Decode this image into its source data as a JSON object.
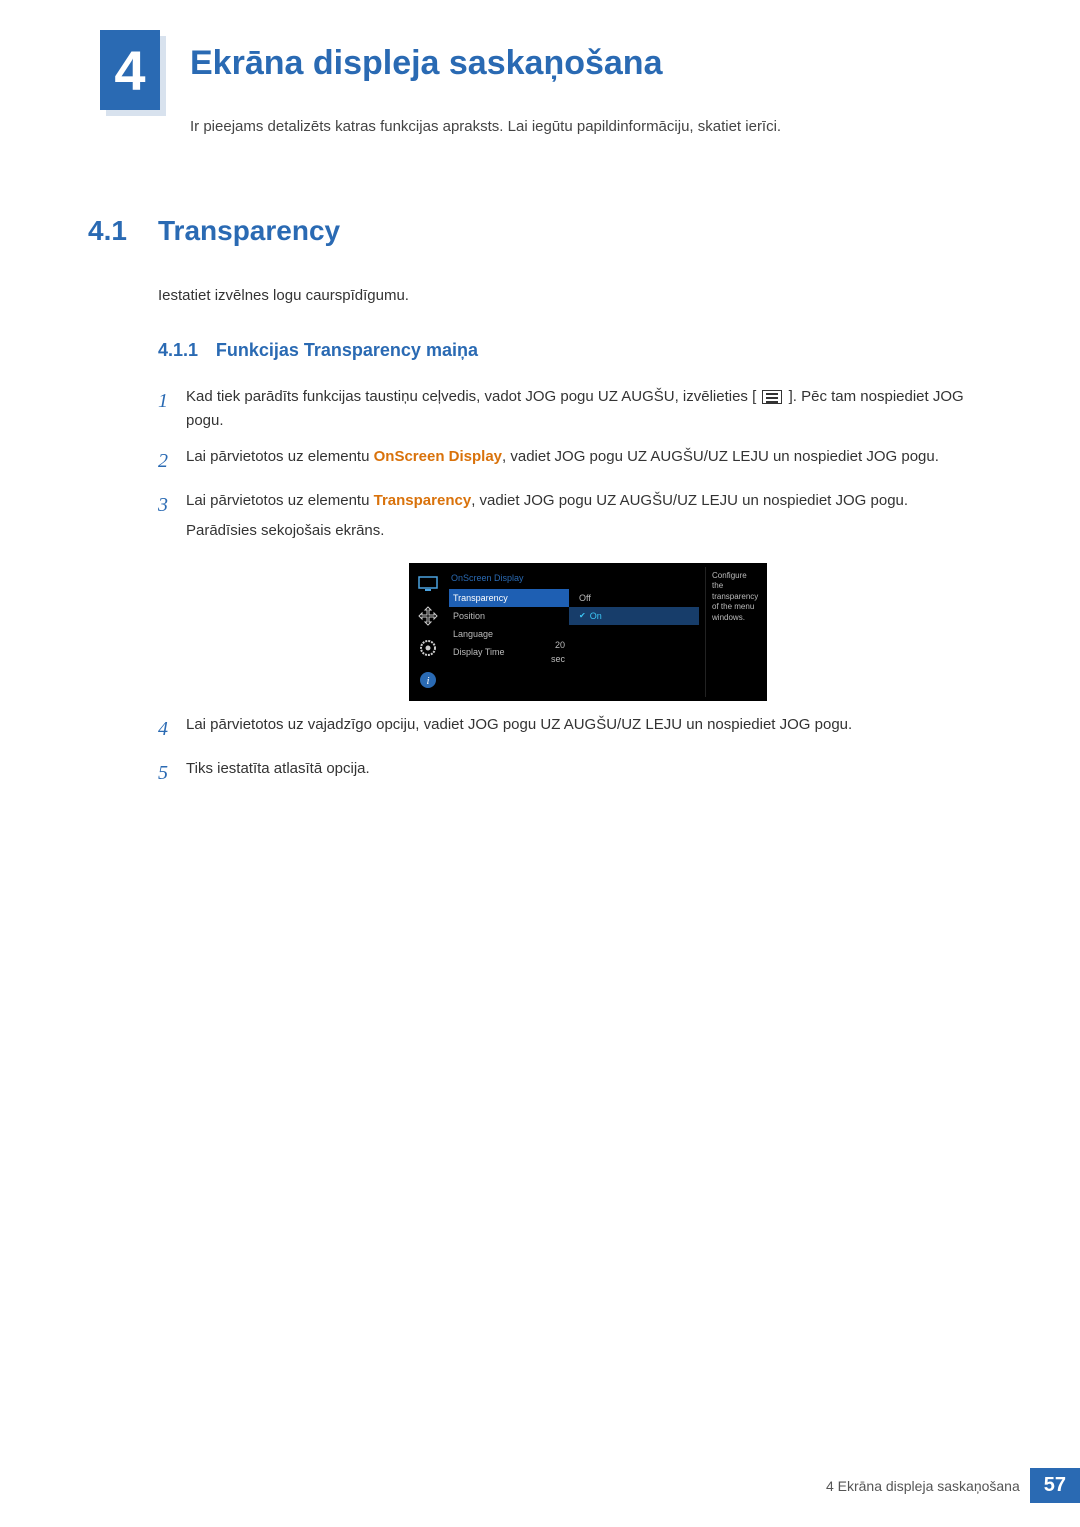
{
  "chapter": {
    "number": "4",
    "title": "Ekrāna displeja saskaņošana",
    "subtitle": "Ir pieejams detalizēts katras funkcijas apraksts. Lai iegūtu papildinformāciju, skatiet ierīci."
  },
  "section": {
    "number": "4.1",
    "title": "Transparency",
    "desc": "Iestatiet izvēlnes logu caurspīdīgumu."
  },
  "subsection": {
    "number": "4.1.1",
    "title": "Funkcijas Transparency maiņa"
  },
  "steps": {
    "s1a": "Kad tiek parādīts funkcijas taustiņu ceļvedis, vadot JOG pogu UZ AUGŠU, izvēlieties [",
    "s1b": "]. Pēc tam nospiediet JOG pogu.",
    "s2a": "Lai pārvietotos uz elementu ",
    "s2_orange": "OnScreen Display",
    "s2b": ", vadiet JOG pogu UZ AUGŠU/UZ LEJU un nospiediet JOG pogu.",
    "s3a": "Lai pārvietotos uz elementu ",
    "s3_orange": "Transparency",
    "s3b": ", vadiet JOG pogu UZ AUGŠU/UZ LEJU un nospiediet JOG pogu.",
    "s3_extra": "Parādīsies sekojošais ekrāns.",
    "s4": "Lai pārvietotos uz vajadzīgo opciju, vadiet JOG pogu UZ AUGŠU/UZ LEJU un nospiediet JOG pogu.",
    "s5": "Tiks iestatīta atlasītā opcija."
  },
  "step_nums": {
    "n1": "1",
    "n2": "2",
    "n3": "3",
    "n4": "4",
    "n5": "5"
  },
  "osd": {
    "menu_title": "OnScreen Display",
    "items": {
      "transparency": "Transparency",
      "position": "Position",
      "language": "Language",
      "display_time": "Display Time"
    },
    "options": {
      "off": "Off",
      "on": "On"
    },
    "display_time_val": "20 sec",
    "desc": "Configure the transparency of the menu windows."
  },
  "footer": {
    "text": "4 Ekrāna displeja saskaņošana",
    "page": "57"
  }
}
